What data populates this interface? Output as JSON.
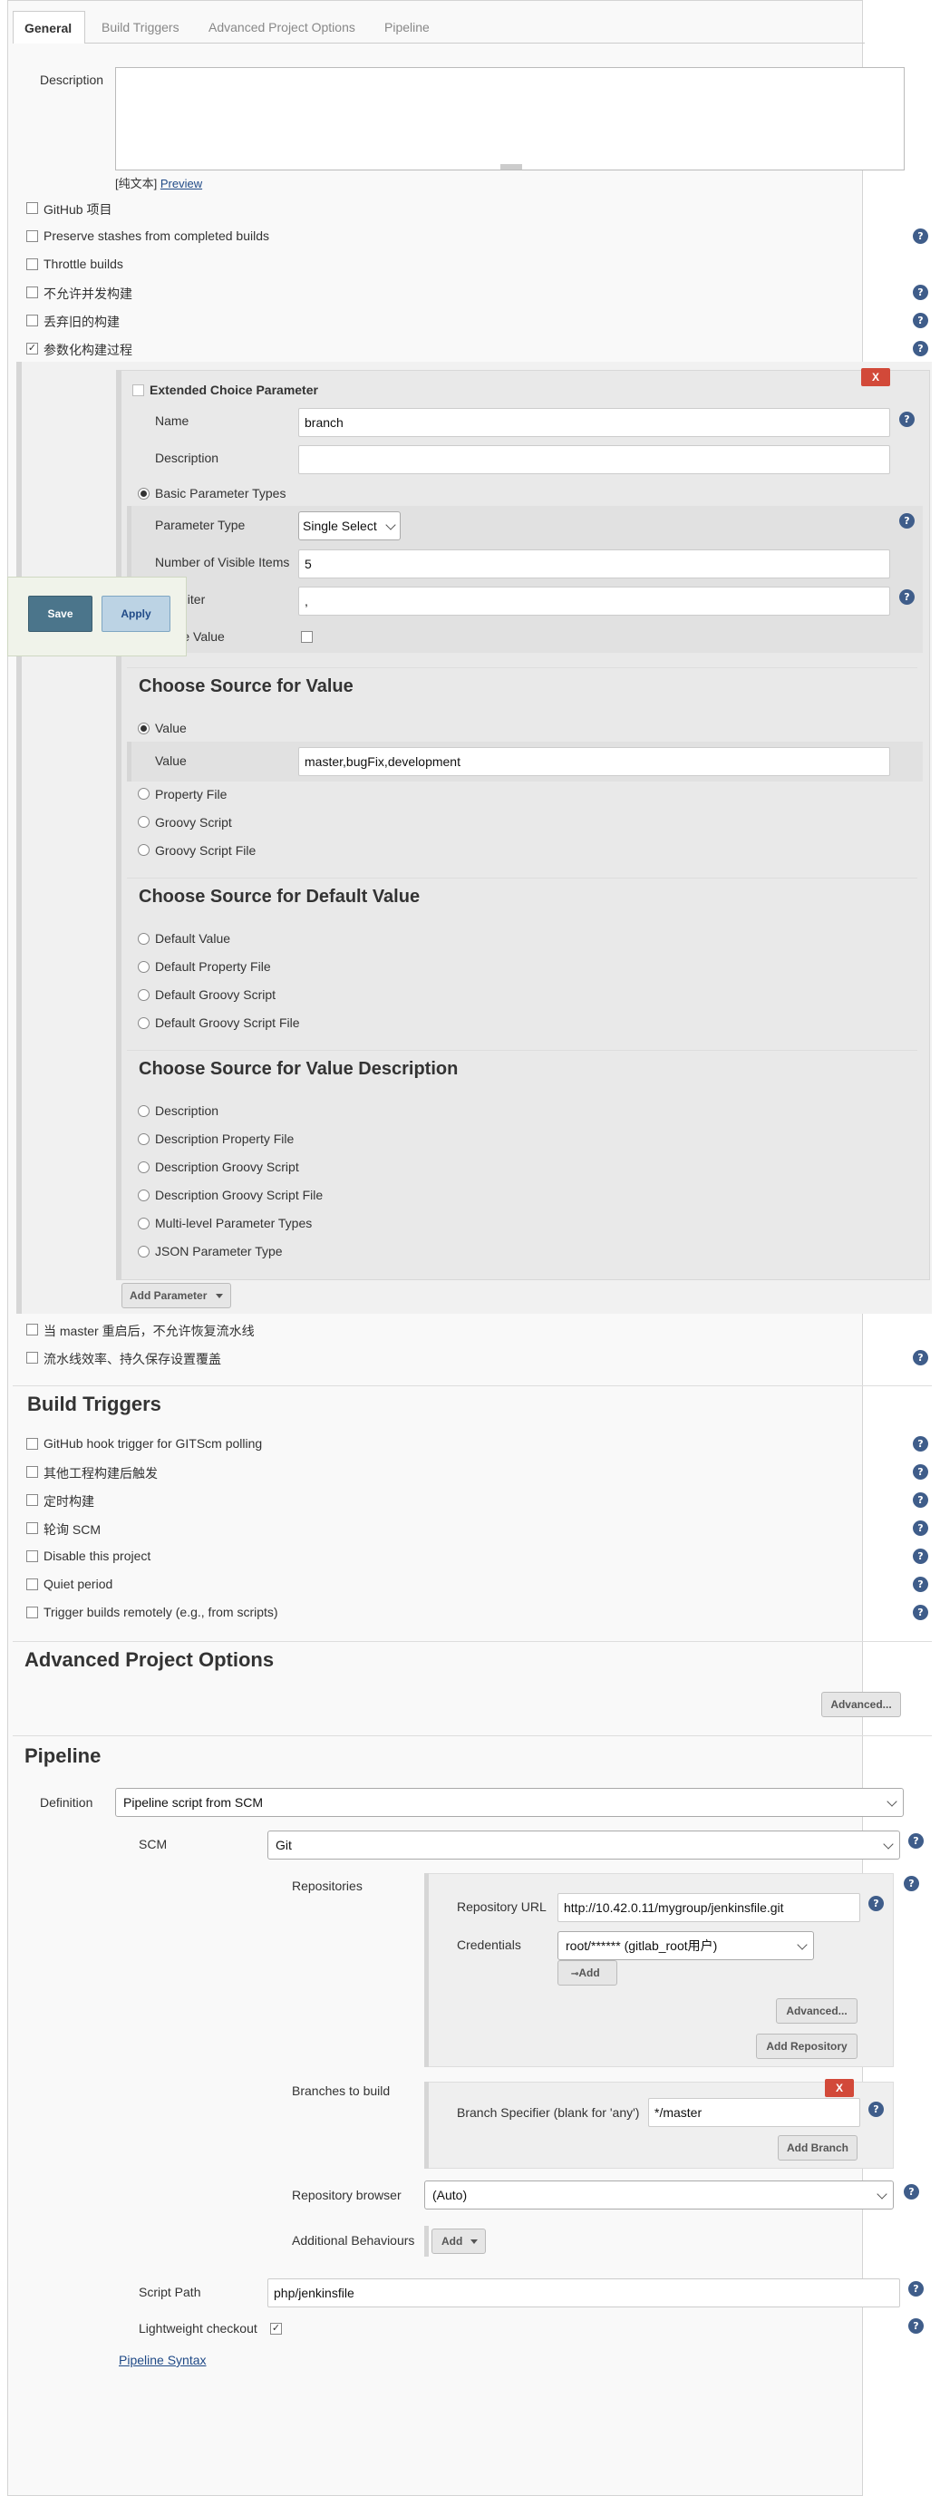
{
  "tabs": [
    "General",
    "Build Triggers",
    "Advanced Project Options",
    "Pipeline"
  ],
  "general": {
    "description_label": "Description",
    "plain_text": "[纯文本]",
    "preview": "Preview",
    "options": [
      {
        "label": "GitHub 项目",
        "checked": false
      },
      {
        "label": "Preserve stashes from completed builds",
        "checked": false
      },
      {
        "label": "Throttle builds",
        "checked": false
      },
      {
        "label": "不允许并发构建",
        "checked": false
      },
      {
        "label": "丢弃旧的构建",
        "checked": false
      },
      {
        "label": "参数化构建过程",
        "checked": true
      }
    ]
  },
  "param": {
    "title": "Extended Choice Parameter",
    "remove": "X",
    "name_label": "Name",
    "name_value": "branch",
    "desc_label": "Description",
    "desc_value": "",
    "basic_types": "Basic Parameter Types",
    "ptype_label": "Parameter Type",
    "ptype_value": "Single Select",
    "visible_label": "Number of Visible Items",
    "visible_value": "5",
    "delimiter_label": "Delimiter",
    "delimiter_value": ",",
    "quote_label": "Quote Value",
    "src_title": "Choose Source for Value",
    "value_radio": "Value",
    "value_label": "Value",
    "value_value": "master,bugFix,development",
    "src_opts": [
      "Property File",
      "Groovy Script",
      "Groovy Script File"
    ],
    "def_title": "Choose Source for Default Value",
    "def_opts": [
      "Default Value",
      "Default Property File",
      "Default Groovy Script",
      "Default Groovy Script File"
    ],
    "vd_title": "Choose Source for Value Description",
    "vd_opts": [
      "Description",
      "Description Property File",
      "Description Groovy Script",
      "Description Groovy Script File",
      "Multi-level Parameter Types",
      "JSON Parameter Type"
    ],
    "add_param": "Add Parameter"
  },
  "float": {
    "save": "Save",
    "apply": "Apply"
  },
  "general_more": [
    "当 master 重启后，不允许恢复流水线",
    "流水线效率、持久保存设置覆盖"
  ],
  "triggers": {
    "title": "Build Triggers",
    "options": [
      "GitHub hook trigger for GITScm polling",
      "其他工程构建后触发",
      "定时构建",
      "轮询 SCM",
      "Disable this project",
      "Quiet period",
      "Trigger builds remotely (e.g., from scripts)"
    ]
  },
  "advanced": {
    "title": "Advanced Project Options",
    "button": "Advanced..."
  },
  "pipeline": {
    "title": "Pipeline",
    "definition_label": "Definition",
    "definition_value": "Pipeline script from SCM",
    "scm_label": "SCM",
    "scm_value": "Git",
    "repos_label": "Repositories",
    "repo_url_label": "Repository URL",
    "repo_url_value": "http://10.42.0.11/mygroup/jenkinsfile.git",
    "cred_label": "Credentials",
    "cred_value": "root/****** (gitlab_root用户)",
    "add_cred": "Add",
    "advanced_btn": "Advanced...",
    "add_repo": "Add Repository",
    "branches_label": "Branches to build",
    "branch_spec_label": "Branch Specifier (blank for 'any')",
    "branch_spec_value": "*/master",
    "add_branch": "Add Branch",
    "browser_label": "Repository browser",
    "browser_value": "(Auto)",
    "behaviours_label": "Additional Behaviours",
    "behaviours_add": "Add",
    "script_path_label": "Script Path",
    "script_path_value": "php/jenkinsfile",
    "lightweight_label": "Lightweight checkout",
    "syntax_link": "Pipeline Syntax"
  }
}
